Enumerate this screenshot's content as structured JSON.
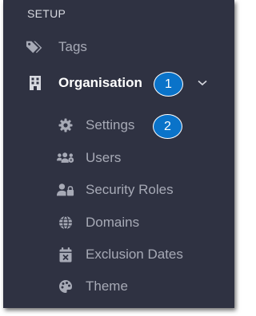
{
  "section": {
    "title": "SETUP"
  },
  "nav": {
    "tags": {
      "label": "Tags",
      "icon": "tags-icon"
    },
    "organisation": {
      "label": "Organisation",
      "icon": "building-icon",
      "expanded": true
    },
    "sub_items": [
      {
        "label": "Settings",
        "icon": "gear-icon"
      },
      {
        "label": "Users",
        "icon": "users-icon"
      },
      {
        "label": "Security Roles",
        "icon": "user-lock-icon"
      },
      {
        "label": "Domains",
        "icon": "globe-icon"
      },
      {
        "label": "Exclusion Dates",
        "icon": "calendar-x-icon"
      },
      {
        "label": "Theme",
        "icon": "palette-icon"
      }
    ]
  },
  "callouts": [
    "1",
    "2"
  ],
  "colors": {
    "panel_bg": "#2f3242",
    "text_muted": "#a7aab6",
    "text_active": "#ffffff",
    "callout_blue": "#0a73c9"
  }
}
